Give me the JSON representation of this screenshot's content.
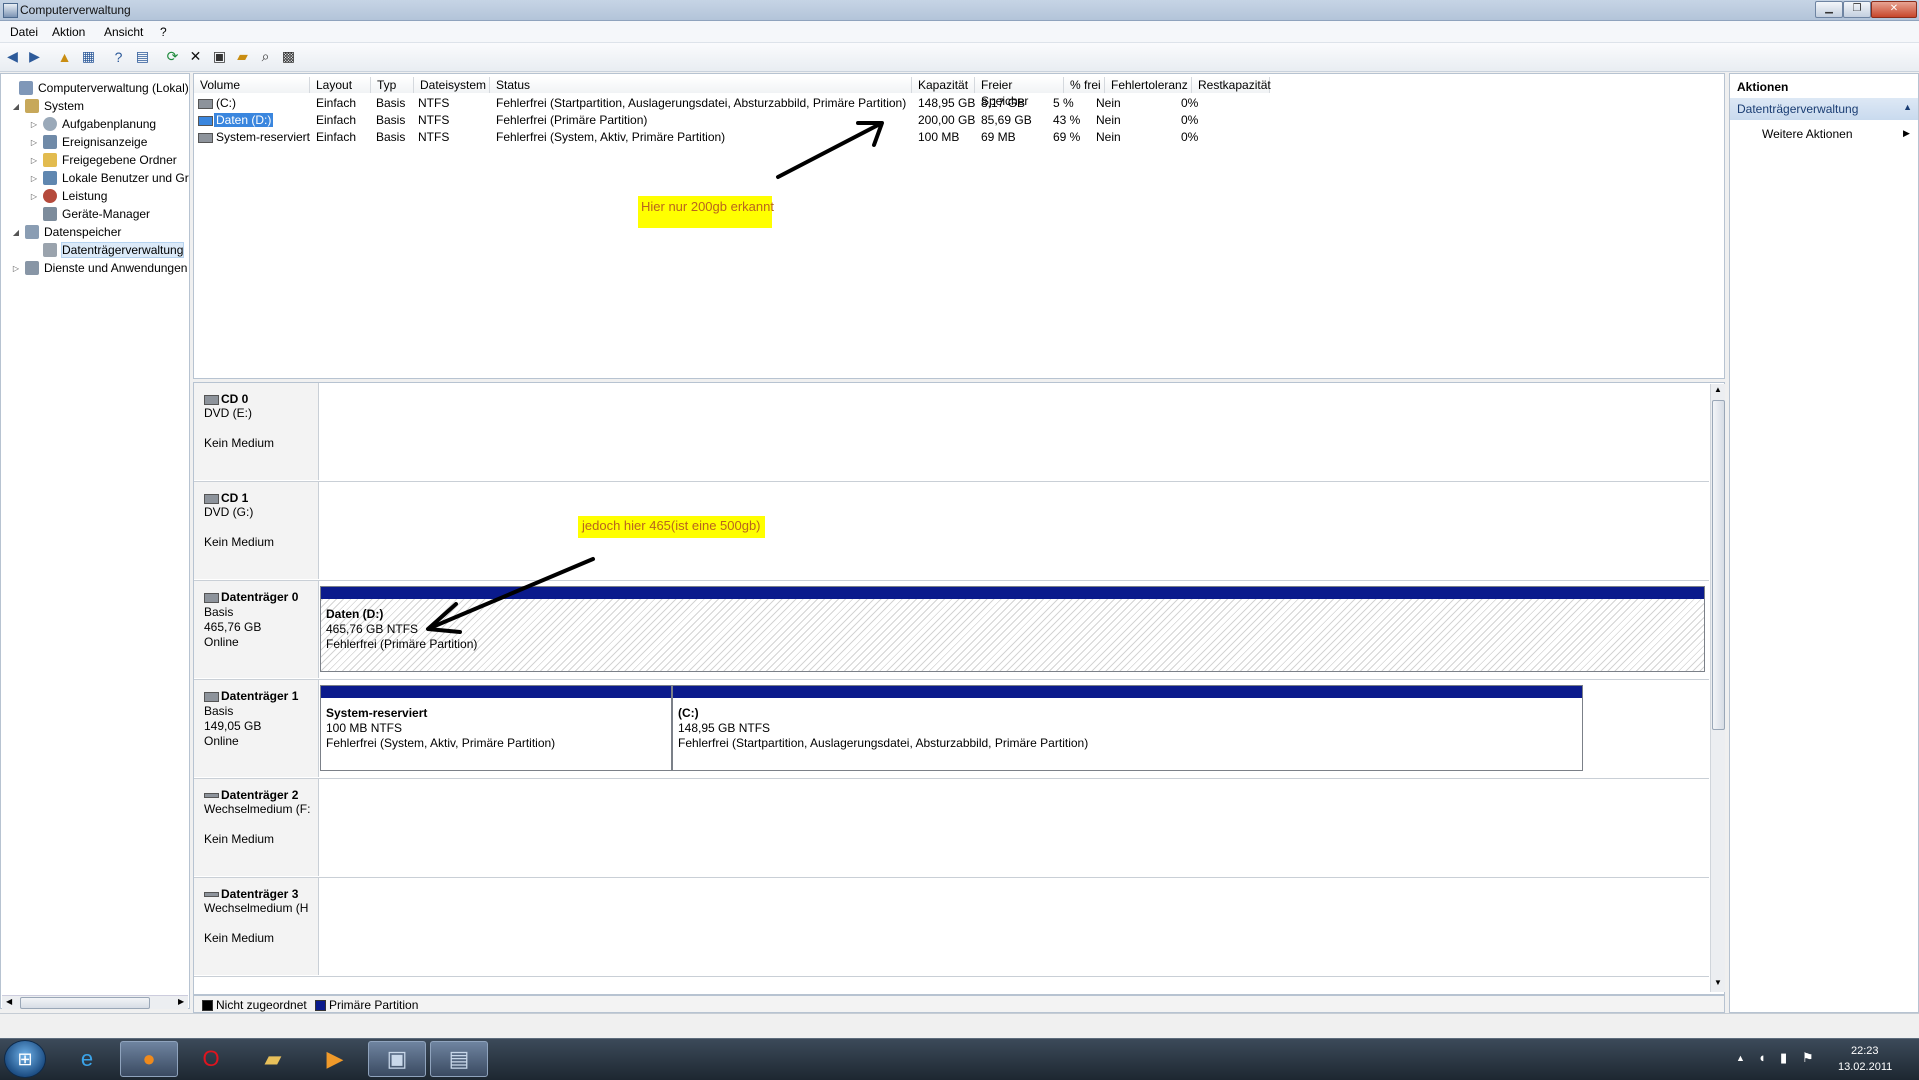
{
  "window": {
    "title": "Computerverwaltung",
    "min_icon": "minimize-icon",
    "max_icon": "maximize-icon",
    "close_icon": "close-icon"
  },
  "menu": [
    "Datei",
    "Aktion",
    "Ansicht",
    "?"
  ],
  "tree": [
    {
      "label": "Computerverwaltung (Lokal)",
      "icon": "computer-management-icon",
      "level": 0,
      "expander": ""
    },
    {
      "label": "System",
      "icon": "tools-icon",
      "level": 1,
      "expander": "◢"
    },
    {
      "label": "Aufgabenplanung",
      "icon": "clock-icon",
      "level": 2,
      "expander": "▷"
    },
    {
      "label": "Ereignisanzeige",
      "icon": "event-log-icon",
      "level": 2,
      "expander": "▷"
    },
    {
      "label": "Freigegebene Ordner",
      "icon": "shared-folder-icon",
      "level": 2,
      "expander": "▷"
    },
    {
      "label": "Lokale Benutzer und Gr",
      "icon": "users-icon",
      "level": 2,
      "expander": "▷"
    },
    {
      "label": "Leistung",
      "icon": "performance-icon",
      "level": 2,
      "expander": "▷"
    },
    {
      "label": "Geräte-Manager",
      "icon": "device-manager-icon",
      "level": 2,
      "expander": ""
    },
    {
      "label": "Datenspeicher",
      "icon": "storage-icon",
      "level": 1,
      "expander": "◢"
    },
    {
      "label": "Datenträgerverwaltung",
      "icon": "disk-management-icon",
      "level": 2,
      "expander": "",
      "selected": true
    },
    {
      "label": "Dienste und Anwendungen",
      "icon": "services-icon",
      "level": 1,
      "expander": "▷"
    }
  ],
  "volumes": {
    "columns": [
      "Volume",
      "Layout",
      "Typ",
      "Dateisystem",
      "Status",
      "Kapazität",
      "Freier Speicher",
      "% frei",
      "Fehlertoleranz",
      "Restkapazität"
    ],
    "rows": [
      {
        "volume": "(C:)",
        "layout": "Einfach",
        "typ": "Basis",
        "fs": "NTFS",
        "status": "Fehlerfrei (Startpartition, Auslagerungsdatei, Absturzabbild, Primäre Partition)",
        "kap": "148,95 GB",
        "frei": "8,17 GB",
        "pct": "5 %",
        "ft": "Nein",
        "rest": "0%"
      },
      {
        "volume": "Daten (D:)",
        "layout": "Einfach",
        "typ": "Basis",
        "fs": "NTFS",
        "status": "Fehlerfrei (Primäre Partition)",
        "kap": "200,00 GB",
        "frei": "85,69 GB",
        "pct": "43 %",
        "ft": "Nein",
        "rest": "0%"
      },
      {
        "volume": "System-reserviert",
        "layout": "Einfach",
        "typ": "Basis",
        "fs": "NTFS",
        "status": "Fehlerfrei (System, Aktiv, Primäre Partition)",
        "kap": "100 MB",
        "frei": "69 MB",
        "pct": "69 %",
        "ft": "Nein",
        "rest": "0%"
      }
    ]
  },
  "annotations": {
    "note1": "Hier nur 200gb erkannt",
    "note2": "jedoch hier 465(ist eine 500gb)"
  },
  "disks": [
    {
      "name": "CD 0",
      "line1": "DVD (E:)",
      "line2": "",
      "line3": "Kein Medium",
      "icon": "cd-drive-icon"
    },
    {
      "name": "CD 1",
      "line1": "DVD (G:)",
      "line2": "",
      "line3": "Kein Medium",
      "icon": "cd-drive-icon"
    },
    {
      "name": "Datenträger 0",
      "line1": "Basis",
      "line2": "465,76 GB",
      "line3": "Online",
      "icon": "hard-disk-icon",
      "partitions": [
        {
          "title": "Daten  (D:)",
          "size": "465,76 GB NTFS",
          "status": "Fehlerfrei (Primäre Partition)"
        }
      ]
    },
    {
      "name": "Datenträger 1",
      "line1": "Basis",
      "line2": "149,05 GB",
      "line3": "Online",
      "icon": "hard-disk-icon",
      "partitions": [
        {
          "title": "System-reserviert",
          "size": "100 MB NTFS",
          "status": "Fehlerfrei (System, Aktiv, Primäre Partition)"
        },
        {
          "title": "(C:)",
          "size": "148,95 GB NTFS",
          "status": "Fehlerfrei (Startpartition, Auslagerungsdatei, Absturzabbild, Primäre Partition)"
        }
      ]
    },
    {
      "name": "Datenträger 2",
      "line1": "Wechselmedium (F:",
      "line2": "",
      "line3": "Kein Medium",
      "icon": "removable-disk-icon"
    },
    {
      "name": "Datenträger 3",
      "line1": "Wechselmedium (H",
      "line2": "",
      "line3": "Kein Medium",
      "icon": "removable-disk-icon"
    }
  ],
  "legend": {
    "unallocated": "Nicht zugeordnet",
    "primary": "Primäre Partition",
    "unallocated_color": "#000000",
    "primary_color": "#0a1a8c"
  },
  "actions": {
    "header": "Aktionen",
    "section": "Datenträgerverwaltung",
    "more": "Weitere Aktionen"
  },
  "taskbar": {
    "apps": [
      "start-orb-icon",
      "internet-explorer-icon",
      "firefox-icon",
      "opera-icon",
      "explorer-icon",
      "media-player-icon",
      "computer-management-icon",
      "disk-management-icon"
    ],
    "time": "22:23",
    "date": "13.02.2011"
  },
  "colors": {
    "primary_partition": "#0a1a8c",
    "annotation_bg": "#ffff00",
    "selection": "#3a86de"
  }
}
